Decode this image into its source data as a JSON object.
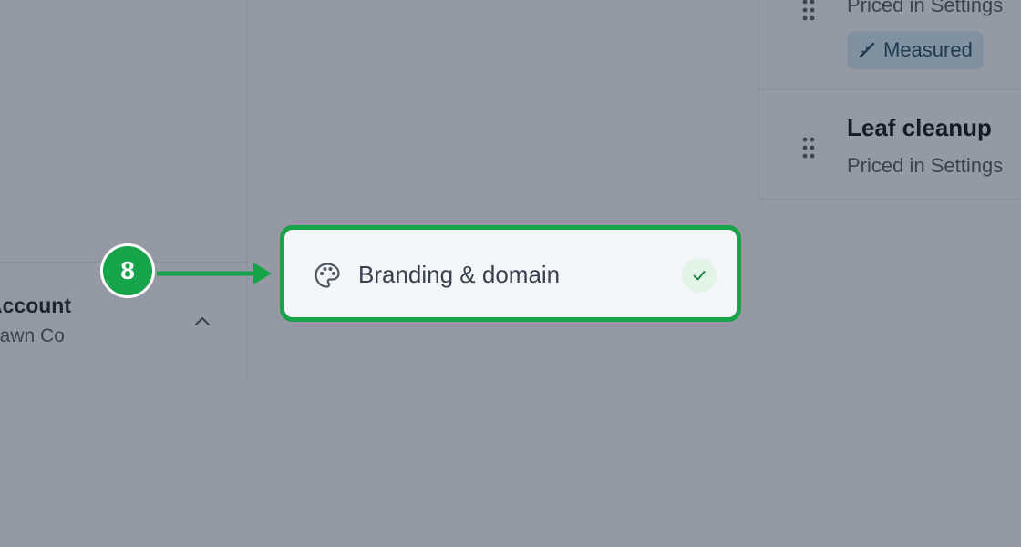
{
  "sidebar": {
    "account": {
      "name": "Account",
      "subtitle": "Lawn Co",
      "toggle_icon": "chevron-up-icon"
    }
  },
  "services": [
    {
      "subtitle": "Priced in Settings",
      "badge": {
        "label": "Measured",
        "icon": "ruler-icon"
      }
    },
    {
      "name": "Leaf cleanup",
      "subtitle": "Priced in Settings"
    }
  ],
  "callout": {
    "step_number": "8"
  },
  "highlight": {
    "label": "Branding & domain",
    "icon": "palette-icon",
    "status_icon": "check-icon"
  },
  "colors": {
    "overlay": "#9599a4",
    "accent_green": "#16a34a",
    "card_background": "#f4f6f9",
    "badge_text": "#1e3a52"
  }
}
